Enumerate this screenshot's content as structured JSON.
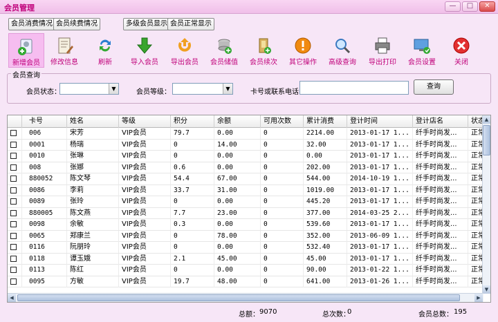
{
  "window": {
    "title": "会员管理",
    "buttons": [
      {
        "name": "minimize-button",
        "label": "—"
      },
      {
        "name": "maximize-button",
        "label": "□"
      },
      {
        "name": "close-button",
        "label": "✕"
      }
    ]
  },
  "tabs": [
    {
      "name": "tab-consumption",
      "label": "会员消费情况"
    },
    {
      "name": "tab-renewal",
      "label": "会员续费情况"
    },
    {
      "name": "tab-multilevel",
      "label": "多级会员显示"
    },
    {
      "name": "tab-normal",
      "label": "会员正常显示"
    }
  ],
  "toolbar": {
    "items": [
      {
        "name": "add-member",
        "label": "新增会员",
        "icon": "add-user-icon"
      },
      {
        "name": "edit-info",
        "label": "修改信息",
        "icon": "edit-document-icon"
      },
      {
        "name": "refresh",
        "label": "刷新",
        "icon": "refresh-icon"
      },
      {
        "name": "import-members",
        "label": "导入会员",
        "icon": "import-arrow-icon"
      },
      {
        "name": "export-members",
        "label": "导出会员",
        "icon": "export-arrow-icon"
      },
      {
        "name": "member-deposit",
        "label": "会员储值",
        "icon": "coins-icon"
      },
      {
        "name": "member-renew",
        "label": "会员续次",
        "icon": "renew-icon"
      },
      {
        "name": "other-ops",
        "label": "其它操作",
        "icon": "warning-icon"
      },
      {
        "name": "advanced-search",
        "label": "高级查询",
        "icon": "magnifier-icon"
      },
      {
        "name": "export-print",
        "label": "导出打印",
        "icon": "printer-icon"
      },
      {
        "name": "member-settings",
        "label": "会员设置",
        "icon": "settings-monitor-icon"
      },
      {
        "name": "close",
        "label": "关闭",
        "icon": "close-circle-icon"
      }
    ]
  },
  "search": {
    "group_title": "会员查询",
    "status_label": "会员状态：",
    "status_value": "",
    "level_label": "会员等级：",
    "level_value": "",
    "card_label": "卡号或联系电话",
    "card_value": "",
    "button_label": "查询"
  },
  "table": {
    "columns": [
      "",
      "卡号",
      "姓名",
      "等级",
      "积分",
      "余额",
      "可用次数",
      "累计消费",
      "登计时间",
      "登计店名",
      "状态"
    ],
    "rows": [
      [
        "006",
        "宋芳",
        "VIP会员",
        "79.7",
        "0.00",
        "0",
        "2214.00",
        "2013-01-17 1...",
        "纤手时尚发...",
        "正常"
      ],
      [
        "0001",
        "杨瑞",
        "VIP会员",
        "0",
        "14.00",
        "0",
        "32.00",
        "2013-01-17 1...",
        "纤手时尚发...",
        "正常"
      ],
      [
        "0010",
        "张琳",
        "VIP会员",
        "0",
        "0.00",
        "0",
        "0.00",
        "2013-01-17 1...",
        "纤手时尚发...",
        "正常"
      ],
      [
        "008",
        "张娜",
        "VIP会员",
        "0.6",
        "0.00",
        "0",
        "202.00",
        "2013-01-17 1...",
        "纤手时尚发...",
        "正常"
      ],
      [
        "880052",
        "陈文琴",
        "VIP会员",
        "54.4",
        "67.00",
        "0",
        "544.00",
        "2014-10-19 1...",
        "纤手时尚发...",
        "正常"
      ],
      [
        "0086",
        "李莉",
        "VIP会员",
        "33.7",
        "31.00",
        "0",
        "1019.00",
        "2013-01-17 1...",
        "纤手时尚发...",
        "正常"
      ],
      [
        "0089",
        "张玲",
        "VIP会员",
        "0",
        "0.00",
        "0",
        "445.20",
        "2013-01-17 1...",
        "纤手时尚发...",
        "正常"
      ],
      [
        "880005",
        "陈文燕",
        "VIP会员",
        "7.7",
        "23.00",
        "0",
        "377.00",
        "2014-03-25 2...",
        "纤手时尚发...",
        "正常"
      ],
      [
        "0098",
        "余敏",
        "VIP会员",
        "0.3",
        "0.00",
        "0",
        "539.60",
        "2013-01-17 1...",
        "纤手时尚发...",
        "正常"
      ],
      [
        "0065",
        "郑康兰",
        "VIP会员",
        "0",
        "78.00",
        "0",
        "352.00",
        "2013-06-09 1...",
        "纤手时尚发...",
        "正常"
      ],
      [
        "0116",
        "阮朋玲",
        "VIP会员",
        "0",
        "0.00",
        "0",
        "532.40",
        "2013-01-17 1...",
        "纤手时尚发...",
        "正常"
      ],
      [
        "0118",
        "谭玉娥",
        "VIP会员",
        "2.1",
        "45.00",
        "0",
        "45.00",
        "2013-01-17 1...",
        "纤手时尚发...",
        "正常"
      ],
      [
        "0113",
        "陈红",
        "VIP会员",
        "0",
        "0.00",
        "0",
        "90.00",
        "2013-01-22 1...",
        "纤手时尚发...",
        "正常"
      ],
      [
        "0095",
        "方敏",
        "VIP会员",
        "19.7",
        "48.00",
        "0",
        "641.00",
        "2013-01-26 1...",
        "纤手时尚发...",
        "正常"
      ]
    ]
  },
  "status": {
    "total_amount_label": "总额：",
    "total_amount": "9070",
    "total_count_label": "总次数：",
    "total_count": "0",
    "member_total_label": "会员总数：",
    "member_total": "195"
  }
}
